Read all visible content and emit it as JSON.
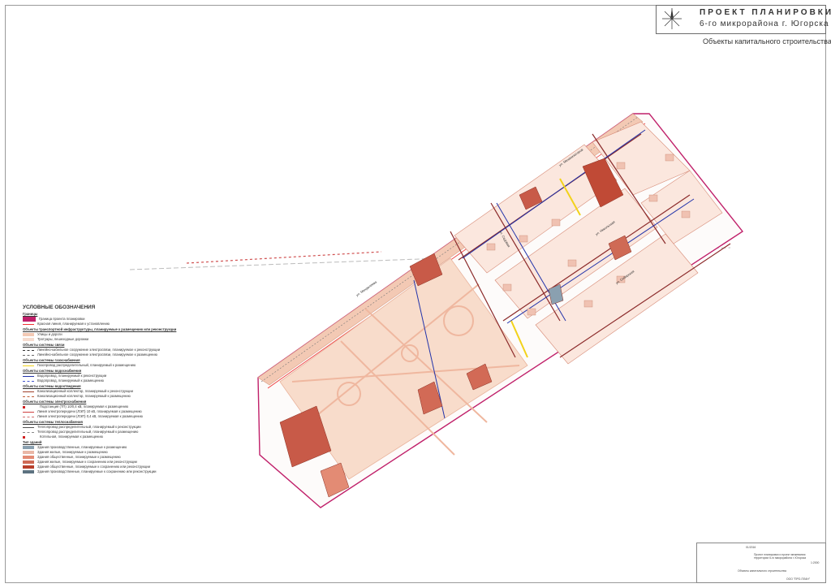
{
  "title": {
    "main": "ПРОЕКТ ПЛАНИРОВКИ",
    "sub": "6-го микрорайона  г. Югорска",
    "subtitle": "Объекты капитального строительства"
  },
  "legend": {
    "heading": "УСЛОВНЫЕ ОБОЗНАЧЕНИЯ",
    "sections": [
      {
        "title": "Границы",
        "items": [
          {
            "label": "Граница проекта планировки",
            "color": "#c0206a",
            "kind": "box"
          },
          {
            "label": "Красная линия, планируемая к установлению",
            "color": "#e33",
            "kind": "line"
          }
        ]
      },
      {
        "title": "Объекты транспортной инфраструктуры, планируемые к размещению или реконструкции",
        "items": [
          {
            "label": "Улицы и дороги",
            "color": "#f3c9b4",
            "kind": "fill"
          },
          {
            "label": "Тротуары, пешеходные дорожки",
            "color": "#f6dccf",
            "kind": "fill"
          }
        ]
      },
      {
        "title": "Объекты системы связи",
        "items": [
          {
            "label": "Линейно-кабельное сооружение электросвязи, планируемое к реконструкции",
            "color": "#333",
            "kind": "dash"
          },
          {
            "label": "Линейно-кабельное сооружение электросвязи, планируемое к размещению",
            "color": "#666",
            "kind": "dash"
          }
        ]
      },
      {
        "title": "Объекты системы газоснабжения",
        "items": [
          {
            "label": "Газопровод распределительный, планируемый к размещению",
            "color": "#f2d21b",
            "kind": "line"
          }
        ]
      },
      {
        "title": "Объекты системы водоснабжения",
        "items": [
          {
            "label": "Водопровод, планируемый к реконструкции",
            "color": "#2233aa",
            "kind": "line"
          },
          {
            "label": "Водопровод, планируемый к размещению",
            "color": "#4455cc",
            "kind": "dash"
          }
        ]
      },
      {
        "title": "Объекты системы водоотведения",
        "items": [
          {
            "label": "Канализационный коллектор, планируемый к реконструкции",
            "color": "#a0402a",
            "kind": "line"
          },
          {
            "label": "Канализационный коллектор, планируемый к размещению",
            "color": "#c0603a",
            "kind": "dash"
          }
        ]
      },
      {
        "title": "Объекты системы электроснабжения",
        "items": [
          {
            "label": "Подстанция (ТП) 10/0,4 кВ, планируемая к размещению",
            "color": "#d02020",
            "kind": "mark"
          },
          {
            "label": "Линия электропередачи (ЛЭП) 10 кВ, планируемая к размещению",
            "color": "#d04040",
            "kind": "line"
          },
          {
            "label": "Линия электропередачи (ЛЭП) 0,4 кВ, планируемая к размещению",
            "color": "#d07070",
            "kind": "dash"
          }
        ]
      },
      {
        "title": "Объекты системы теплоснабжения",
        "items": [
          {
            "label": "Теплопровод распределительный, планируемый к реконструкции",
            "color": "#555",
            "kind": "line"
          },
          {
            "label": "Теплопровод распределительный, планируемый к размещению",
            "color": "#888",
            "kind": "dash"
          },
          {
            "label": "Котельная, планируемая к размещению",
            "color": "#d02020",
            "kind": "mark"
          }
        ]
      },
      {
        "title": "Тип зданий",
        "items": [
          {
            "label": "Здания производственные, планируемые к размещению",
            "color": "#8aa0b0",
            "kind": "fill"
          },
          {
            "label": "Здания жилые, планируемые к размещению",
            "color": "#e9b7a6",
            "kind": "fill"
          },
          {
            "label": "Здания общественные, планируемые к размещению",
            "color": "#e38b74",
            "kind": "fill"
          },
          {
            "label": "Здания жилые, планируемые к сохранению или реконструкции",
            "color": "#cf6a55",
            "kind": "fill"
          },
          {
            "label": "Здания общественные, планируемые к сохранению или реконструкции",
            "color": "#b8402c",
            "kind": "fill"
          },
          {
            "label": "Здания производственные, планируемые к сохранению или реконструкции",
            "color": "#5d7280",
            "kind": "fill"
          }
        ]
      }
    ]
  },
  "streets": [
    "ул. Менделеева",
    "ул. Механизаторов",
    "ул. Садовая",
    "ул. Никольская",
    "ул. Сибирская",
    "ул. Ленина",
    "ул. Кирова"
  ],
  "stamp": {
    "code": "01/2016",
    "project": "Проект планировки и проект межевания территории 6-го микрорайона г. Югорска",
    "sheet_title": "Объекты капитального строительства",
    "scale": "1:2000",
    "org": "ООО \"ПРО-ПЛАН\""
  },
  "colors": {
    "boundary": "#c0206a",
    "road": "#f3c9b4",
    "park": "#f7d9c8",
    "building": "#c85a48",
    "red_line": "#e33",
    "water": "#2233aa",
    "gas": "#f2d21b"
  }
}
